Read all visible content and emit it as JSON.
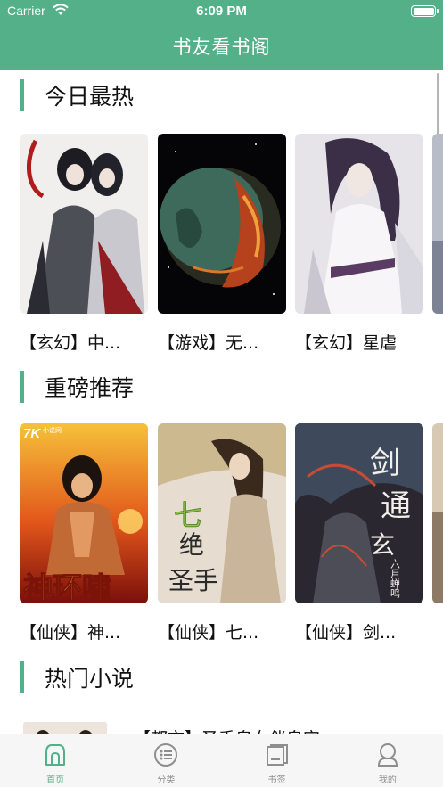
{
  "status": {
    "carrier": "Carrier",
    "time": "6:09 PM"
  },
  "header": {
    "title": "书友看书阁"
  },
  "sections": [
    {
      "title": "今日最热",
      "books": [
        {
          "title": "【玄幻】中..."
        },
        {
          "title": "【游戏】无..."
        },
        {
          "title": "【玄幻】星虐"
        }
      ]
    },
    {
      "title": "重磅推荐",
      "books": [
        {
          "title": "【仙侠】神..."
        },
        {
          "title": "【仙侠】七..."
        },
        {
          "title": "【仙侠】剑..."
        }
      ]
    },
    {
      "title": "热门小说"
    }
  ],
  "hot_list": [
    {
      "title": "【都市】圣手皇女伴皇宫"
    }
  ],
  "covers": {
    "r2b0_text": "神环啸",
    "r2b0_logo": "7K",
    "r2b0_logo_sub": "小说网",
    "r2b1_text1": "七",
    "r2b1_text2": "绝",
    "r2b1_text3": "圣手",
    "r2b2_text1": "剑",
    "r2b2_text2": "通",
    "r2b2_text3": "玄",
    "r2b2_author": "六月蝉鸣"
  },
  "tabs": [
    {
      "label": "首页",
      "icon": "home-icon",
      "active": true
    },
    {
      "label": "分类",
      "icon": "category-icon",
      "active": false
    },
    {
      "label": "书签",
      "icon": "bookmark-icon",
      "active": false
    },
    {
      "label": "我的",
      "icon": "profile-icon",
      "active": false
    }
  ],
  "colors": {
    "accent": "#54b088",
    "tab_inactive": "#8e8e8e"
  }
}
